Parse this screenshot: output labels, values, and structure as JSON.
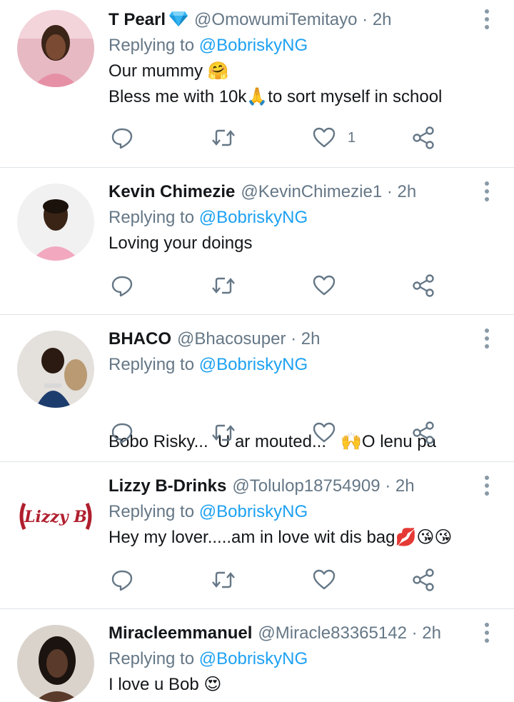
{
  "tweets": [
    {
      "display_name": "T Pearl",
      "verified_icon": "gem-icon",
      "handle": "@OmowumiTemitayo",
      "separator": "·",
      "time": "2h",
      "replying_prefix": "Replying to",
      "replying_handle": "@BobriskyNG",
      "text_line1": "Our mummy 🤗",
      "text_line2": "Bless me with 10k🙏to sort myself in school",
      "like_count": "1"
    },
    {
      "display_name": "Kevin Chimezie",
      "handle": "@KevinChimezie1",
      "separator": "·",
      "time": "2h",
      "replying_prefix": "Replying to",
      "replying_handle": "@BobriskyNG",
      "text_line1": "Loving your doings",
      "like_count": ""
    },
    {
      "display_name": "BHACO",
      "handle": "@Bhacosuper",
      "separator": "·",
      "time": "2h",
      "replying_prefix": "Replying to",
      "replying_handle": "@BobriskyNG",
      "text_line1": "Bobo Risky...  U ar mouted...   🙌O lenu pa",
      "like_count": ""
    },
    {
      "display_name": "Lizzy B-Drinks",
      "handle": "@Tolulop18754909",
      "separator": "·",
      "time": "2h",
      "replying_prefix": "Replying to",
      "replying_handle": "@BobriskyNG",
      "text_line1": "Hey my lover.....am in love wit dis bag💋😘😘",
      "avatar_logo_text": "Lizzy B",
      "like_count": ""
    },
    {
      "display_name": "Miracleemmanuel",
      "handle": "@Miracle83365142",
      "separator": "·",
      "time": "2h",
      "replying_prefix": "Replying to",
      "replying_handle": "@BobriskyNG",
      "text_line1": "I love u Bob 😍",
      "like_count": ""
    }
  ],
  "colors": {
    "name": "#14171a",
    "secondary": "#657786",
    "accent": "#1da1f2",
    "divider": "#dfe3e7"
  },
  "icons": {
    "reply": "reply-icon",
    "retweet": "retweet-icon",
    "like": "heart-icon",
    "share": "share-icon",
    "more": "more-vertical-icon"
  }
}
